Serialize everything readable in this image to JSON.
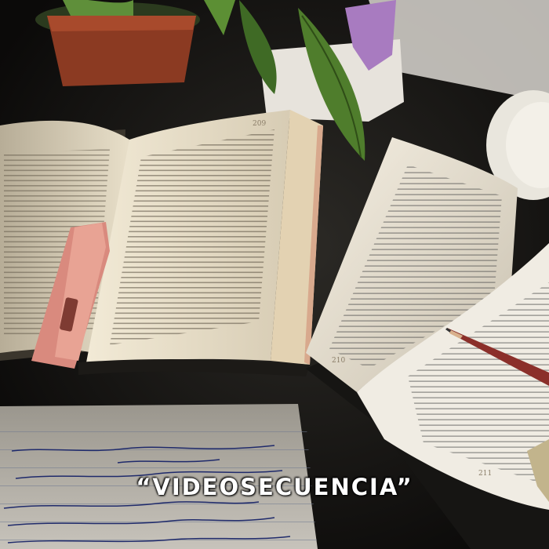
{
  "caption": {
    "text": "“VIDEOSECUENCIA”"
  },
  "folios": {
    "left_book_page": "209",
    "right_book_page_a": "210",
    "right_book_page_b": "211"
  },
  "colors": {
    "background": "#0d0c0b",
    "paper_lit": "#efe6d1",
    "paper_shadow": "#8f8672",
    "leaf_green": "#4f7d2c",
    "highlighter": "#d98a7e",
    "pot": "#8b3a22",
    "caption": "#ffffff"
  },
  "icons": [
    "plant-icon",
    "highlighter-icon",
    "pencil-icon",
    "lamp-icon"
  ]
}
